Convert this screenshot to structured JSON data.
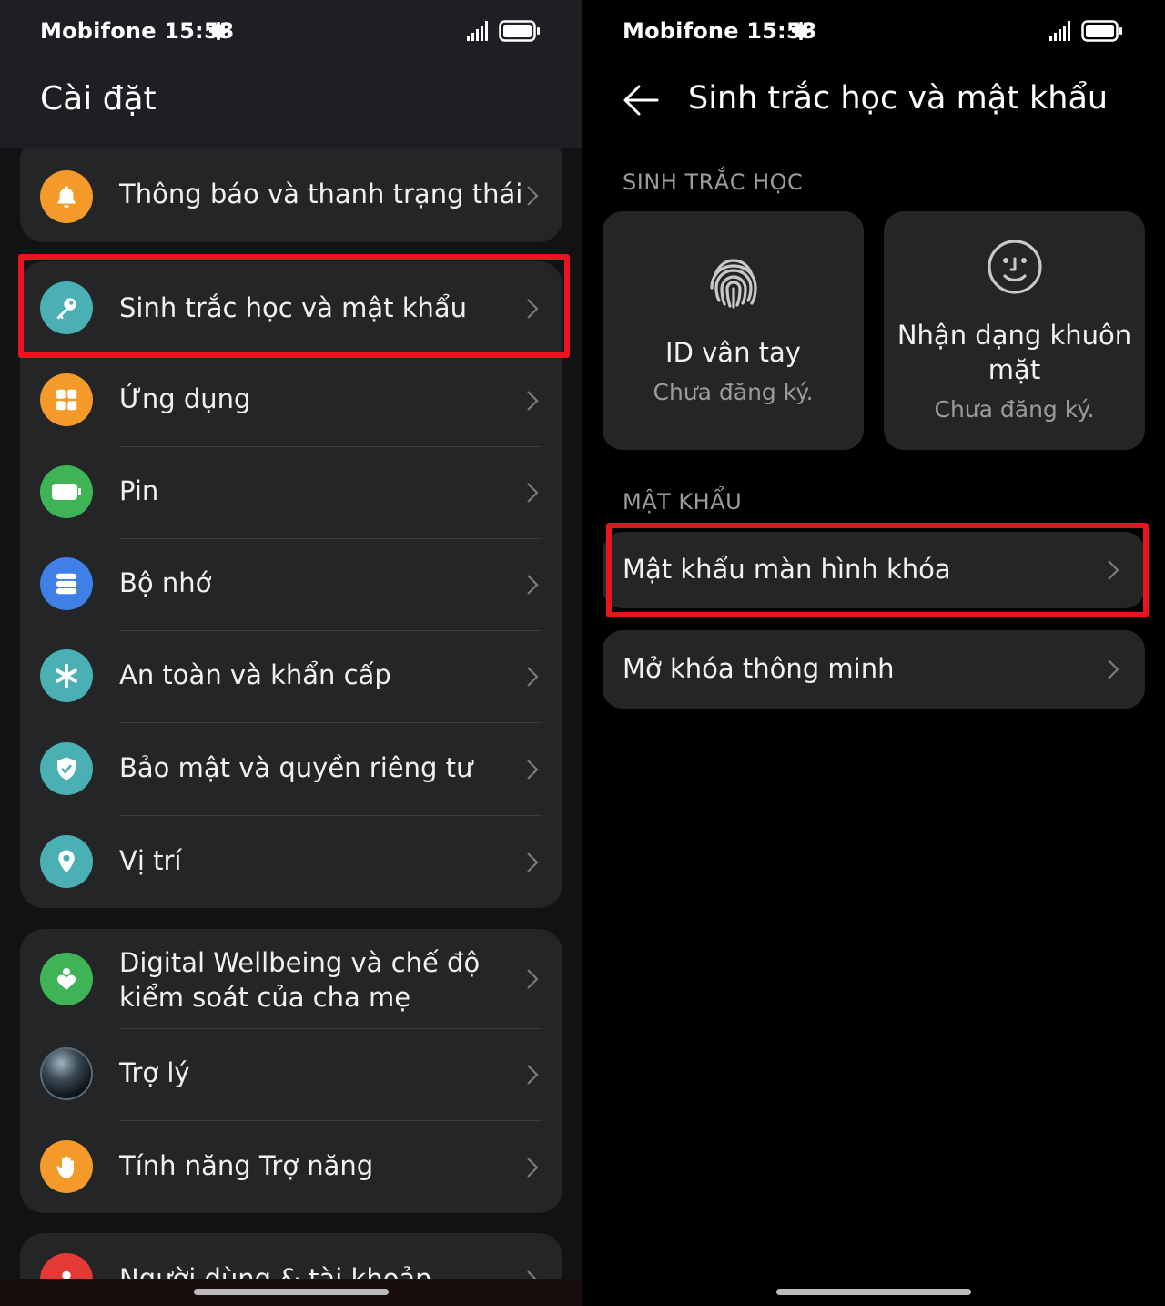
{
  "status": {
    "carrier_time": "Mobifone 15:53"
  },
  "left": {
    "title": "Cài đặt",
    "items": [
      {
        "label": "Thông báo và thanh trạng thái",
        "icon": "bell-icon",
        "color": "#f39a2b"
      },
      {
        "label": "Sinh trắc học và mật khẩu",
        "icon": "key-icon",
        "color": "#4ab0b3"
      },
      {
        "label": "Ứng dụng",
        "icon": "apps-icon",
        "color": "#f39a2b"
      },
      {
        "label": "Pin",
        "icon": "battery-icon",
        "color": "#3fb457"
      },
      {
        "label": "Bộ nhớ",
        "icon": "storage-icon",
        "color": "#3f7fe6"
      },
      {
        "label": "An toàn và khẩn cấp",
        "icon": "asterisk-icon",
        "color": "#4ab0b3"
      },
      {
        "label": "Bảo mật và quyền riêng tư",
        "icon": "shield-icon",
        "color": "#4ab0b3"
      },
      {
        "label": "Vị trí",
        "icon": "location-icon",
        "color": "#4ab0b3"
      },
      {
        "label_line1": "Digital Wellbeing và chế độ",
        "label_line2": "kiểm soát của cha mẹ",
        "icon": "wellbeing-icon",
        "color": "#3fb457"
      },
      {
        "label": "Trợ lý",
        "icon": "assistant-orb-icon",
        "color": "#2a3a44"
      },
      {
        "label": "Tính năng Trợ năng",
        "icon": "hand-icon",
        "color": "#f39a2b"
      },
      {
        "label": "Người dùng & tài khoản",
        "icon": "user-icon",
        "color": "#e53935"
      }
    ]
  },
  "right": {
    "title": "Sinh trắc học và mật khẩu",
    "section_biometric": "SINH TRẮC HỌC",
    "fingerprint": {
      "title": "ID vân tay",
      "status": "Chưa đăng ký."
    },
    "face": {
      "title_line1": "Nhận dạng khuôn",
      "title_line2": "mặt",
      "status": "Chưa đăng ký."
    },
    "section_password": "MẬT KHẨU",
    "lock_password": "Mật khẩu màn hình khóa",
    "smart_unlock": "Mở khóa thông minh"
  },
  "colors": {
    "highlight": "#e8141e",
    "card_bg": "#242527"
  }
}
